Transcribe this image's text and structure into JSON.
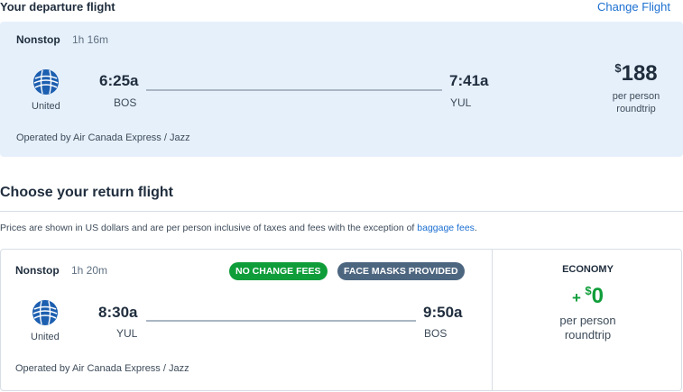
{
  "departure": {
    "heading": "Your departure flight",
    "change_link": "Change Flight",
    "stops": "Nonstop",
    "duration": "1h 16m",
    "airline": "United",
    "depart_time": "6:25a",
    "depart_code": "BOS",
    "arrive_time": "7:41a",
    "arrive_code": "YUL",
    "price_currency": "$",
    "price": "188",
    "price_note_1": "per person",
    "price_note_2": "roundtrip",
    "operated_by": "Operated by Air Canada Express / Jazz"
  },
  "return": {
    "heading": "Choose your return flight",
    "notice_text": "Prices are shown in US dollars and are per person inclusive of taxes and fees with the exception of ",
    "notice_link": "baggage fees",
    "notice_end": ".",
    "stops": "Nonstop",
    "duration": "1h 20m",
    "badges": [
      "NO CHANGE FEES",
      "FACE MASKS PROVIDED"
    ],
    "airline": "United",
    "depart_time": "8:30a",
    "depart_code": "YUL",
    "arrive_time": "9:50a",
    "arrive_code": "BOS",
    "operated_by": "Operated by Air Canada Express / Jazz",
    "fare_class": "ECONOMY",
    "price_prefix": "+",
    "price_currency": "$",
    "price": "0",
    "price_note_1": "per person",
    "price_note_2": "roundtrip"
  },
  "colors": {
    "accent": "#1b6fd1",
    "card_bg": "#e6f0fb",
    "green": "#0f9d3a",
    "slate": "#4d6680"
  }
}
